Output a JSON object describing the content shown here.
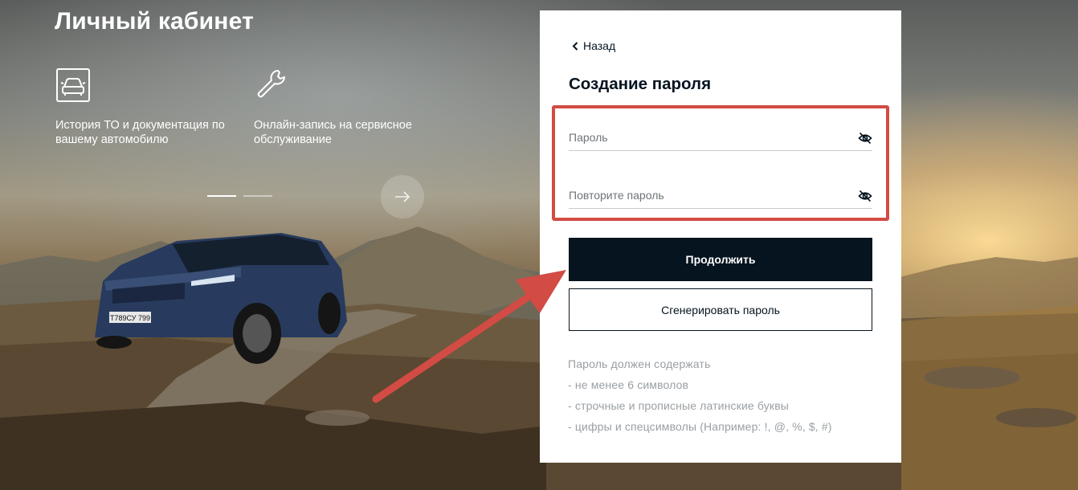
{
  "hero": {
    "title": "Личный кабинет",
    "features": [
      {
        "icon": "car-document-icon",
        "text": "История ТО и документация по вашему автомобилю"
      },
      {
        "icon": "wrench-icon",
        "text": "Онлайн-запись на сервисное обслуживание"
      }
    ],
    "pager": {
      "total": 2,
      "active": 1
    },
    "car_plate": "Т789СУ 799"
  },
  "form": {
    "back_label": "Назад",
    "title": "Создание пароля",
    "password_placeholder": "Пароль",
    "repeat_placeholder": "Повторите пароль",
    "continue_label": "Продолжить",
    "generate_label": "Сгенерировать пароль",
    "rules": [
      "Пароль должен содержать",
      "- не менее 6 символов",
      "- строчные и прописные латинские буквы",
      "- цифры и спецсимволы (Например: !, @, %, $, #)"
    ]
  },
  "colors": {
    "primary": "#05141f",
    "annotation": "#d24b44",
    "hint_text": "#9a9fa3"
  }
}
